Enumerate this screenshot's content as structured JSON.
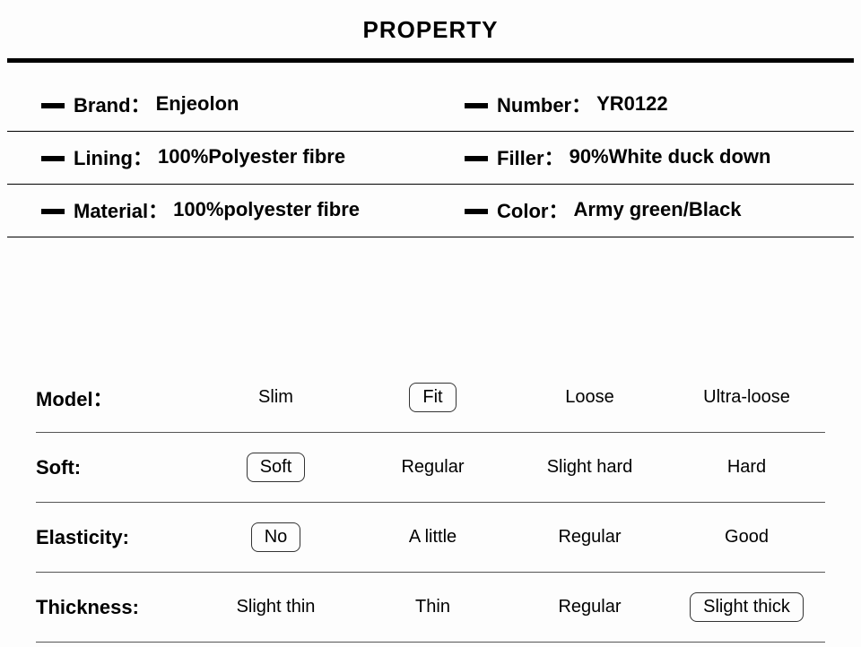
{
  "title": "PROPERTY",
  "properties": [
    [
      {
        "label": "Brand：",
        "value": "Enjeolon"
      },
      {
        "label": "Number：",
        "value": "YR0122"
      }
    ],
    [
      {
        "label": "Lining：",
        "value": "100%Polyester fibre"
      },
      {
        "label": "Filler：",
        "value": "90%White duck down"
      }
    ],
    [
      {
        "label": "Material：",
        "value": "100%polyester fibre"
      },
      {
        "label": "Color：",
        "value": "Army green/Black"
      }
    ]
  ],
  "attributes": [
    {
      "label": "Model：",
      "options": [
        "Slim",
        "Fit",
        "Loose",
        "Ultra-loose"
      ],
      "selected": 1
    },
    {
      "label": "Soft:",
      "options": [
        "Soft",
        "Regular",
        "Slight hard",
        "Hard"
      ],
      "selected": 0
    },
    {
      "label": "Elasticity:",
      "options": [
        "No",
        "A little",
        "Regular",
        "Good"
      ],
      "selected": 0
    },
    {
      "label": "Thickness:",
      "options": [
        "Slight thin",
        "Thin",
        "Regular",
        "Slight thick"
      ],
      "selected": 3
    }
  ]
}
